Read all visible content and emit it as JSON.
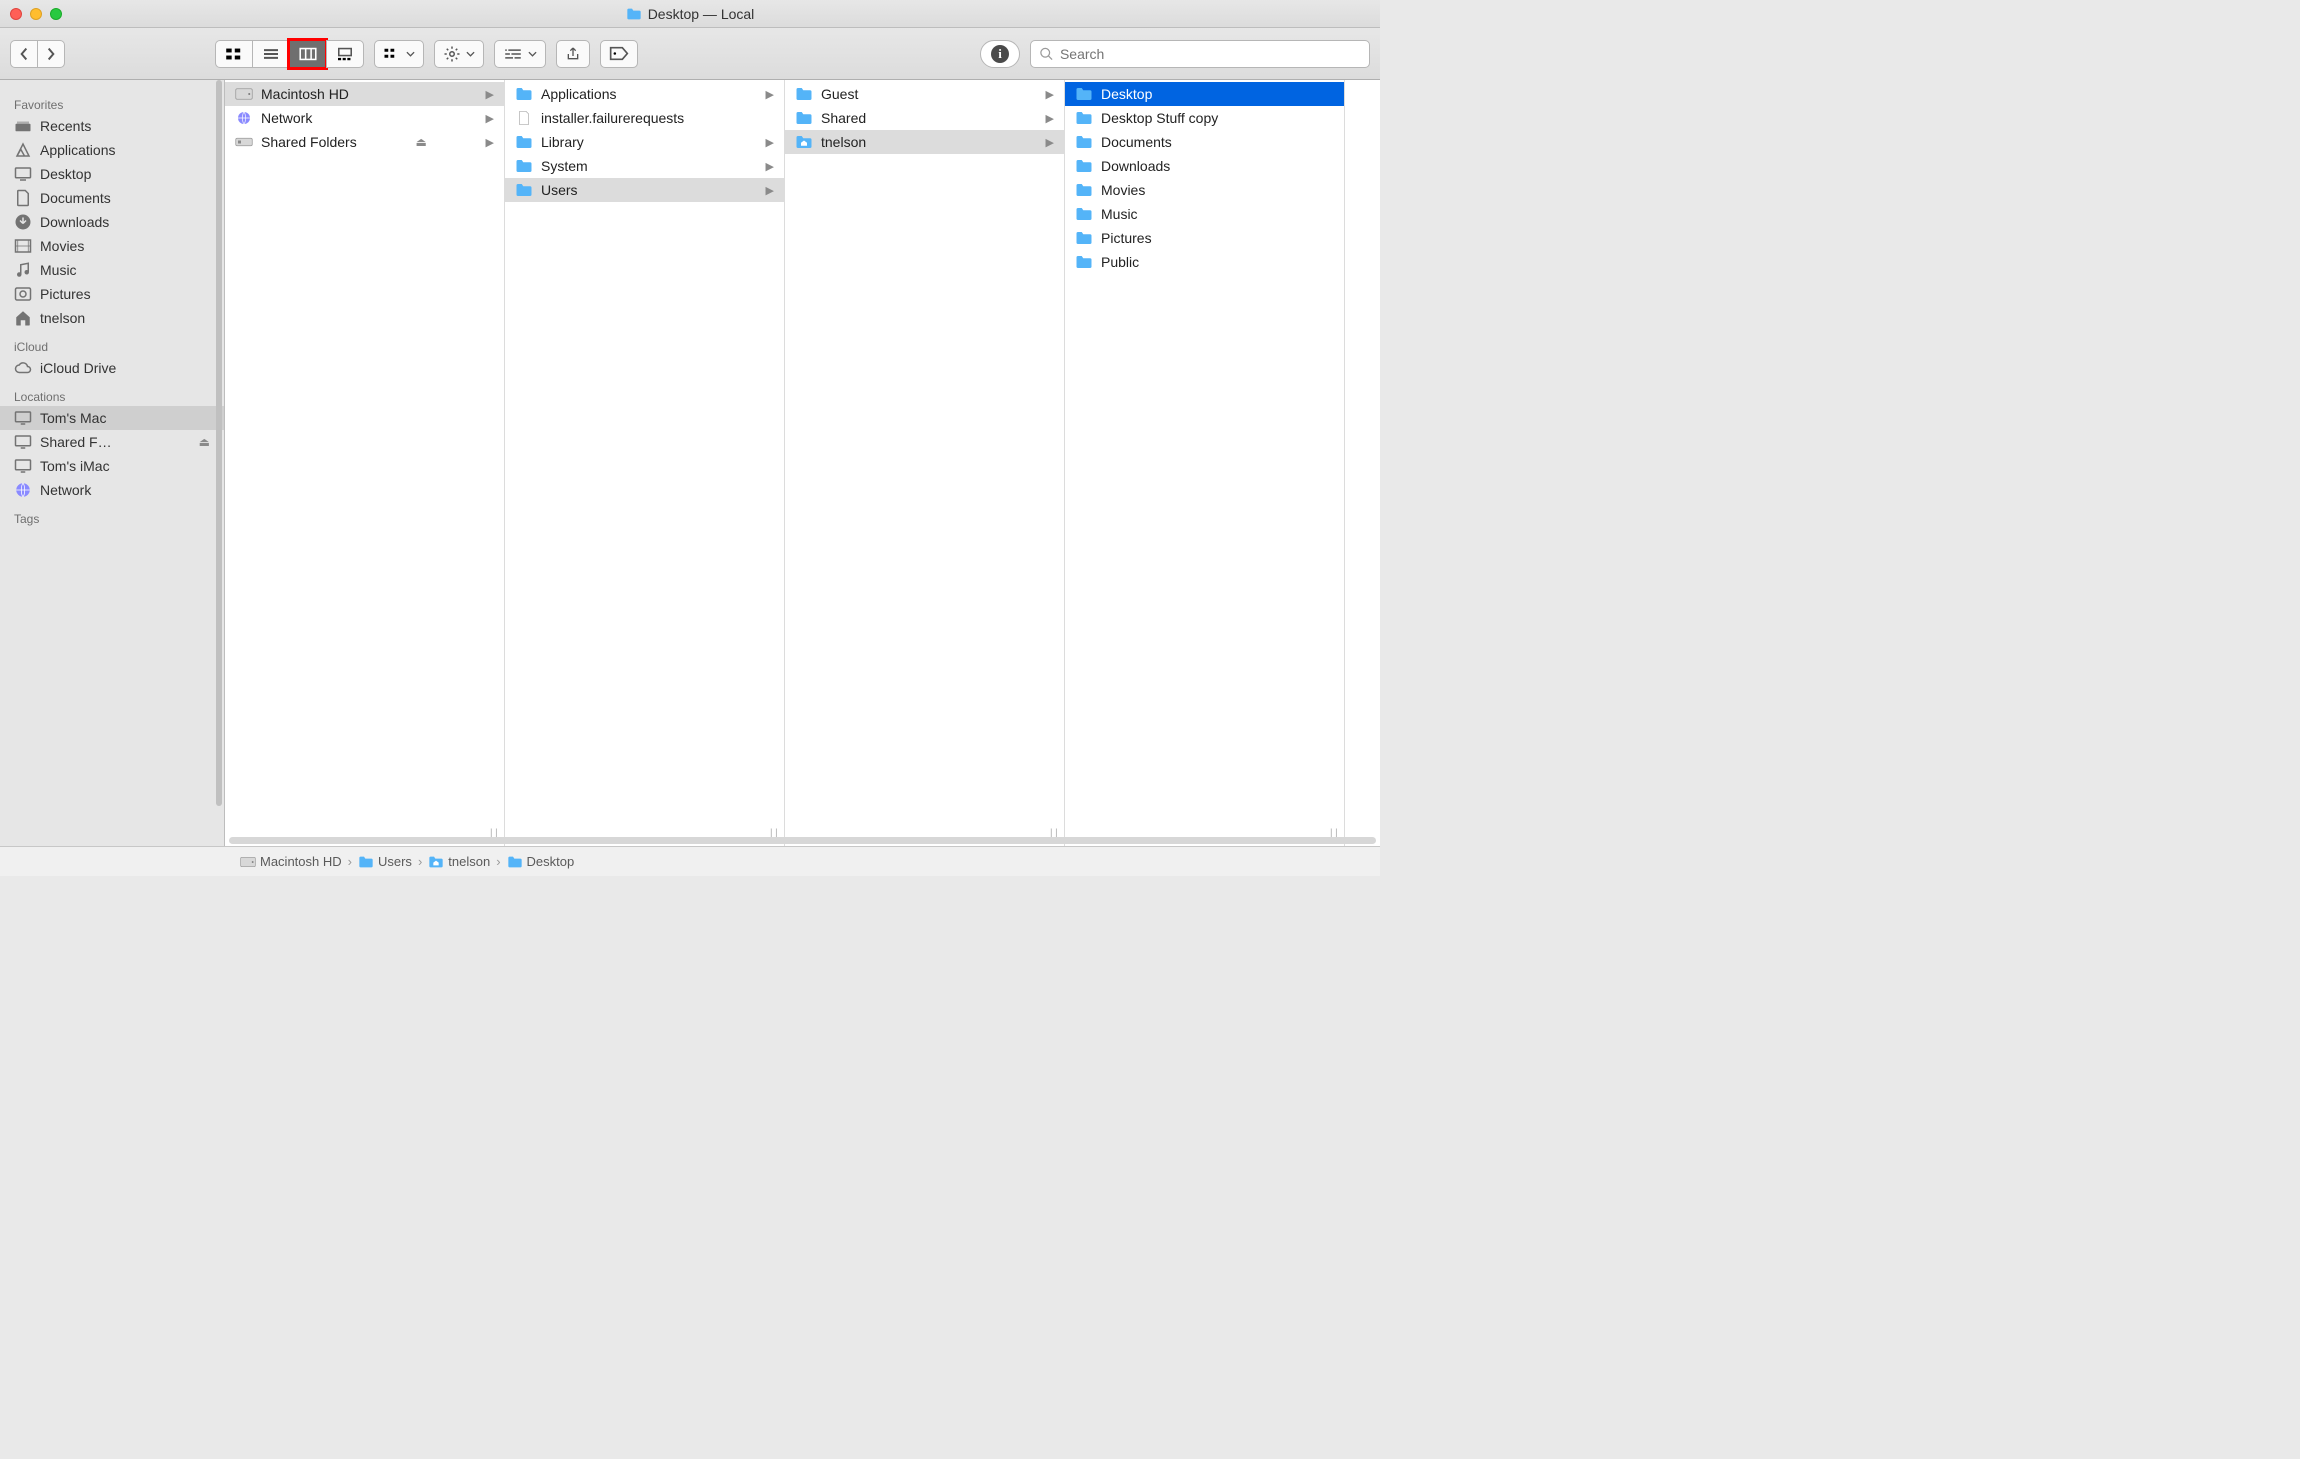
{
  "window": {
    "title": "Desktop — Local"
  },
  "toolbar": {
    "views": [
      "icon",
      "list",
      "column",
      "gallery"
    ],
    "activeView": "column",
    "search_placeholder": "Search"
  },
  "sidebar": {
    "sections": [
      {
        "name": "Favorites",
        "items": [
          {
            "label": "Recents",
            "icon": "recents"
          },
          {
            "label": "Applications",
            "icon": "apps"
          },
          {
            "label": "Desktop",
            "icon": "desktop"
          },
          {
            "label": "Documents",
            "icon": "doc"
          },
          {
            "label": "Downloads",
            "icon": "download"
          },
          {
            "label": "Movies",
            "icon": "movies"
          },
          {
            "label": "Music",
            "icon": "music"
          },
          {
            "label": "Pictures",
            "icon": "pictures"
          },
          {
            "label": "tnelson",
            "icon": "home"
          }
        ]
      },
      {
        "name": "iCloud",
        "items": [
          {
            "label": "iCloud Drive",
            "icon": "cloud"
          }
        ]
      },
      {
        "name": "Locations",
        "items": [
          {
            "label": "Tom's Mac",
            "icon": "monitor",
            "selected": true
          },
          {
            "label": "Shared F…",
            "icon": "monitor",
            "eject": true
          },
          {
            "label": "Tom's iMac",
            "icon": "monitor"
          },
          {
            "label": "Network",
            "icon": "globe"
          }
        ]
      },
      {
        "name": "Tags",
        "items": []
      }
    ]
  },
  "columns": [
    {
      "items": [
        {
          "label": "Macintosh HD",
          "icon": "hd",
          "arrow": true,
          "selected": true
        },
        {
          "label": "Network",
          "icon": "globe",
          "arrow": true
        },
        {
          "label": "Shared Folders",
          "icon": "shared",
          "arrow": true,
          "eject": true
        }
      ]
    },
    {
      "items": [
        {
          "label": "Applications",
          "icon": "folder",
          "arrow": true
        },
        {
          "label": "installer.failurerequests",
          "icon": "file"
        },
        {
          "label": "Library",
          "icon": "folder",
          "arrow": true
        },
        {
          "label": "System",
          "icon": "folder",
          "arrow": true
        },
        {
          "label": "Users",
          "icon": "folder-users",
          "arrow": true,
          "selected": true
        }
      ]
    },
    {
      "items": [
        {
          "label": "Guest",
          "icon": "folder",
          "arrow": true
        },
        {
          "label": "Shared",
          "icon": "folder",
          "arrow": true
        },
        {
          "label": "tnelson",
          "icon": "home-folder",
          "arrow": true,
          "selected": true
        }
      ]
    },
    {
      "items": [
        {
          "label": "Desktop",
          "icon": "folder-desktop",
          "selectedBlue": true
        },
        {
          "label": "Desktop Stuff copy",
          "icon": "folder"
        },
        {
          "label": "Documents",
          "icon": "folder"
        },
        {
          "label": "Downloads",
          "icon": "folder"
        },
        {
          "label": "Movies",
          "icon": "folder"
        },
        {
          "label": "Music",
          "icon": "folder"
        },
        {
          "label": "Pictures",
          "icon": "folder"
        },
        {
          "label": "Public",
          "icon": "folder"
        }
      ]
    }
  ],
  "pathbar": [
    {
      "label": "Macintosh HD",
      "icon": "hd"
    },
    {
      "label": "Users",
      "icon": "folder-users"
    },
    {
      "label": "tnelson",
      "icon": "home-folder"
    },
    {
      "label": "Desktop",
      "icon": "folder"
    }
  ]
}
